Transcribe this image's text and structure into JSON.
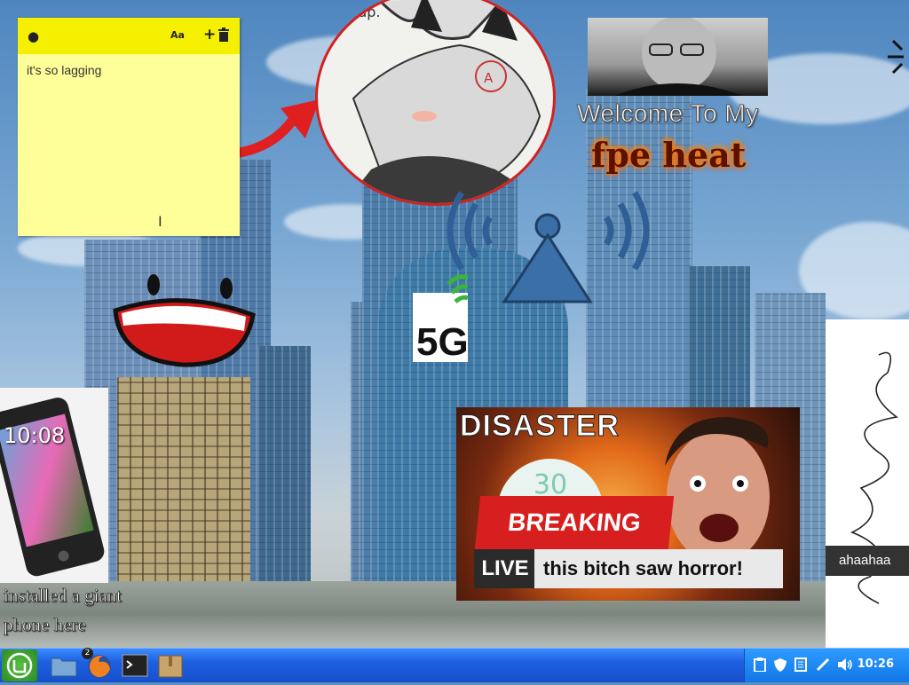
{
  "sticky_note": {
    "text": "it's so lagging",
    "font_icon": "Aa",
    "add_icon": "+",
    "colors": {
      "bar": "#f5f000",
      "body": "#ffff99"
    }
  },
  "circle_image": {
    "caption": "Sup."
  },
  "welcome_meme": {
    "line1": "Welcome To My",
    "line2": "fpe heat"
  },
  "signal_meme": {
    "label": "5G"
  },
  "phone_meme": {
    "time": "10:08",
    "caption_line1": "installed a giant",
    "caption_line2": "phone here"
  },
  "news_thumbnail": {
    "headline": "DISASTER",
    "counter": "30",
    "banner": "BREAKING NEWS",
    "live": "LIVE",
    "ticker": "this bitch saw horror!"
  },
  "scribble_window": {
    "label": "ahaahaa"
  },
  "taskbar": {
    "firefox_badge": "2",
    "clock": "10:26",
    "apps": [
      "menu-icon",
      "files-icon",
      "firefox-icon",
      "terminal-icon",
      "archive-icon"
    ],
    "tray": [
      "clipboard-icon",
      "shield-icon",
      "notes-icon",
      "pen-icon",
      "volume-icon"
    ],
    "colors": {
      "bar": "#1e5fe0",
      "tray": "#1276e6"
    }
  }
}
